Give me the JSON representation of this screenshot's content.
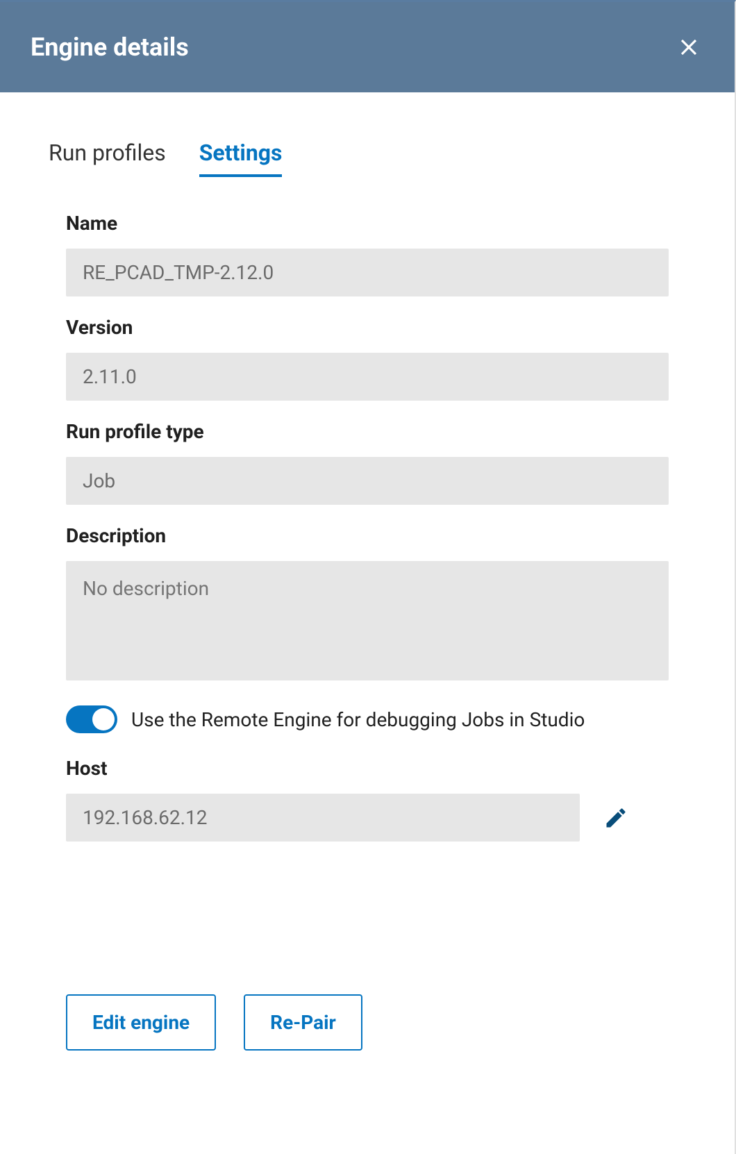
{
  "header": {
    "title": "Engine details"
  },
  "tabs": {
    "run_profiles": "Run profiles",
    "settings": "Settings"
  },
  "fields": {
    "name": {
      "label": "Name",
      "value": "RE_PCAD_TMP-2.12.0"
    },
    "version": {
      "label": "Version",
      "value": "2.11.0"
    },
    "run_profile_type": {
      "label": "Run profile type",
      "value": "Job"
    },
    "description": {
      "label": "Description",
      "placeholder": "No description"
    },
    "host": {
      "label": "Host",
      "value": "192.168.62.12"
    }
  },
  "toggle": {
    "label": "Use the Remote Engine for debugging Jobs in Studio",
    "on": true
  },
  "actions": {
    "edit_engine": "Edit engine",
    "re_pair": "Re-Pair"
  }
}
